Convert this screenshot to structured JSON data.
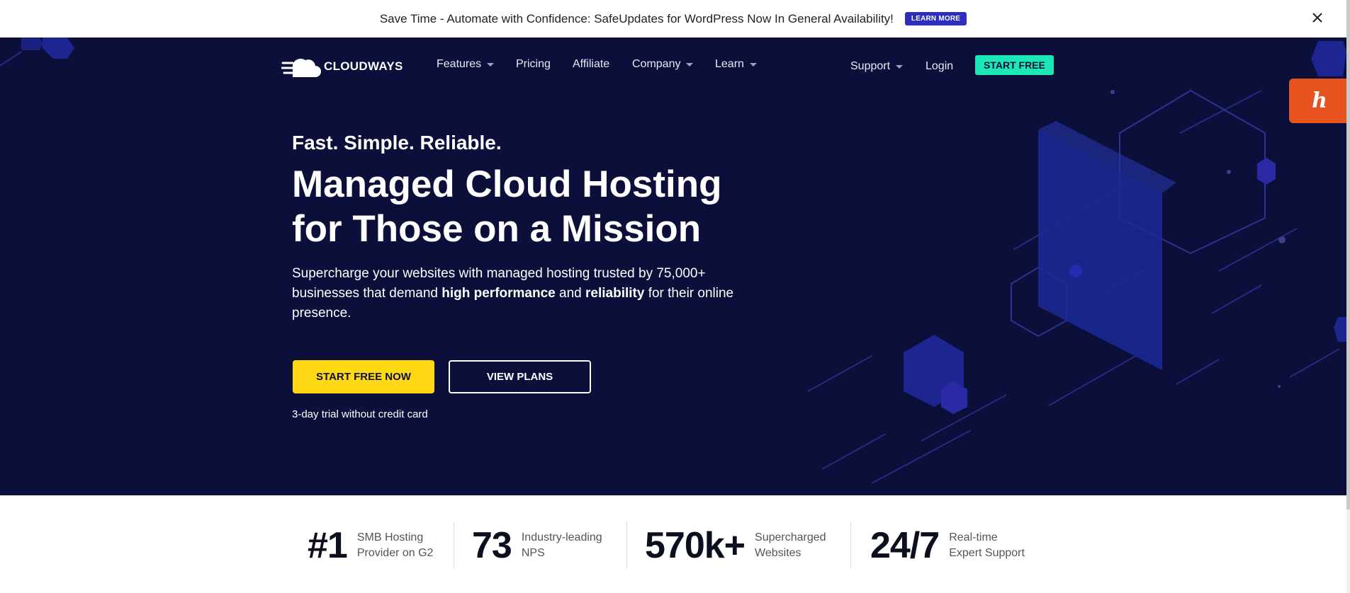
{
  "announcement": {
    "text": "Save Time - Automate with Confidence: SafeUpdates for WordPress Now In General Availability!",
    "button_label": "LEARN MORE",
    "close_icon": "close-icon"
  },
  "nav": {
    "logo_text": "CLOUDWAYS",
    "items": [
      {
        "label": "Features",
        "has_dropdown": true
      },
      {
        "label": "Pricing",
        "has_dropdown": false
      },
      {
        "label": "Affiliate",
        "has_dropdown": false
      },
      {
        "label": "Company",
        "has_dropdown": true
      },
      {
        "label": "Learn",
        "has_dropdown": true
      }
    ],
    "support_label": "Support",
    "login_label": "Login",
    "cta_label": "START FREE"
  },
  "hero": {
    "eyebrow": "Fast. Simple. Reliable.",
    "headline_line1": "Managed Cloud Hosting",
    "headline_line2": "for Those on a Mission",
    "lead_part1": "Supercharge your websites with managed hosting trusted by 75,000+ businesses that demand ",
    "lead_bold1": "high performance",
    "lead_part2": " and ",
    "lead_bold2": "reliability",
    "lead_part3": " for their online presence.",
    "primary_button": "START FREE NOW",
    "secondary_button": "VIEW PLANS",
    "trial_note": "3-day trial without credit card"
  },
  "stats": [
    {
      "value": "#1",
      "label": "SMB Hosting\nProvider on G2"
    },
    {
      "value": "73",
      "label": "Industry-leading\nNPS"
    },
    {
      "value": "570k+",
      "label": "Supercharged\nWebsites"
    },
    {
      "value": "24/7",
      "label": "Real-time\nExpert Support"
    }
  ],
  "colors": {
    "hero_bg": "#0c0f3a",
    "accent_yellow": "#ffd814",
    "accent_teal": "#1ce7b6",
    "announce_button": "#2d2ec0",
    "widget_orange": "#e8541f"
  },
  "widget": {
    "icon": "honey-icon",
    "glyph": "h"
  }
}
